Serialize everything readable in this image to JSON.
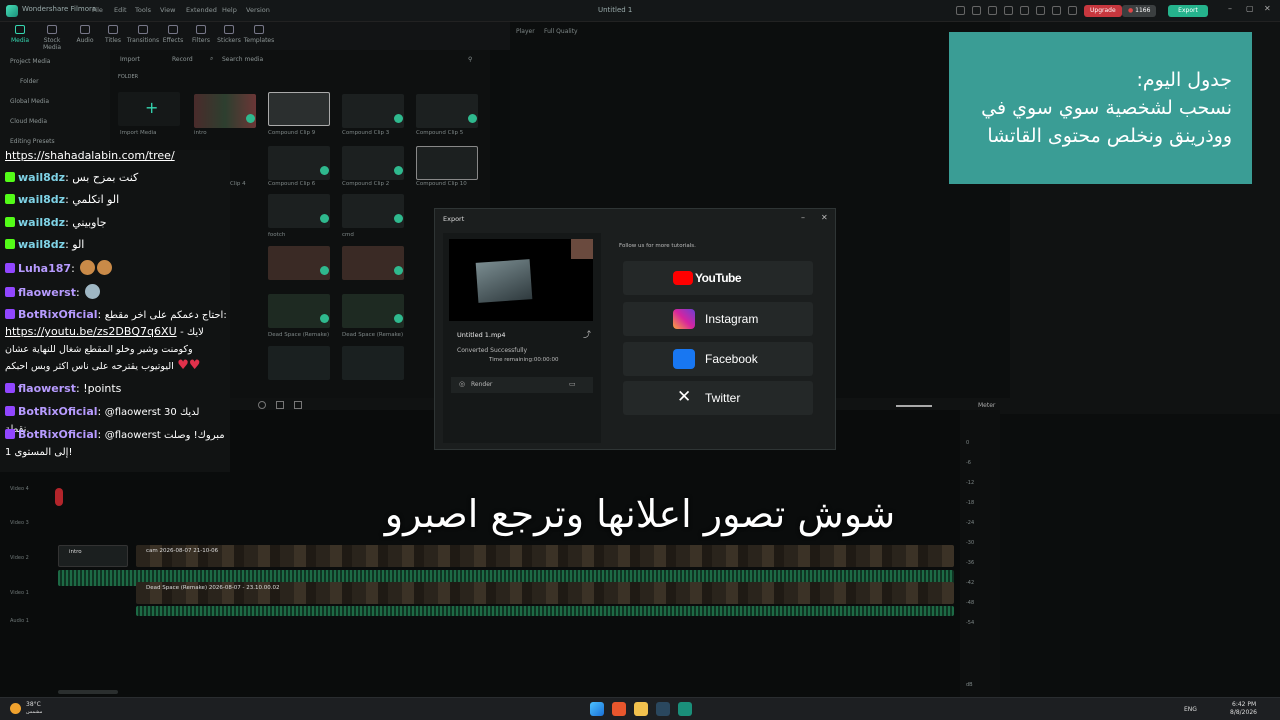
{
  "titlebar": {
    "app_name": "Wondershare Filmora",
    "menus": [
      "File",
      "Edit",
      "Tools",
      "View",
      "Extended",
      "Help",
      "Version"
    ],
    "window_title": "Untitled 1",
    "upgrade": "Upgrade",
    "credits": "1166",
    "export": "Export"
  },
  "toolbar": {
    "tools": [
      "Media",
      "Stock Media",
      "Audio",
      "Titles",
      "Transitions",
      "Effects",
      "Filters",
      "Stickers",
      "Templates"
    ]
  },
  "media": {
    "side_items": [
      "Project Media",
      "Folder",
      "Global Media",
      "Cloud Media",
      "Editing Presets"
    ],
    "import": "Import",
    "record": "Record",
    "search_placeholder": "Search media",
    "folder_label": "FOLDER",
    "import_media": "Import Media",
    "intro": "intro",
    "clip_labels": [
      "Compound Clip 9",
      "Compound Clip 3",
      "Compound Clip 5",
      "Clip 4",
      "Compound Clip 6",
      "Compound Clip 2",
      "Compound Clip 10",
      "footch",
      "cmd",
      "Dead Space (Remake)",
      "Dead Space (Remake)"
    ]
  },
  "player": {
    "label": "Player",
    "quality": "Full Quality"
  },
  "announcement": {
    "lines": [
      "جدول اليوم:",
      "نسحب لشخصية سوي سوي في",
      "ووذرينق ونخلص محتوى القاتشا"
    ]
  },
  "chat": {
    "top_link": "https://shahadalabin.com/tree/",
    "messages": [
      {
        "platform": "kick",
        "user": "wail8dz",
        "text": "كنت بمزح بس"
      },
      {
        "platform": "kick",
        "user": "wail8dz",
        "text": "الو اتكلمي"
      },
      {
        "platform": "kick",
        "user": "wail8dz",
        "text": "جاوبيني"
      },
      {
        "platform": "kick",
        "user": "wail8dz",
        "text": "الو"
      },
      {
        "platform": "twitch",
        "user": "Luha187",
        "text": ""
      },
      {
        "platform": "twitch",
        "user": "flaowerst",
        "text": ""
      },
      {
        "platform": "twitch",
        "user": "BotRixOficial",
        "text": "احتاج دعمكم على اخر مقطع:",
        "link": "https://youtu.be/zs2DBQ7q6XU",
        "text2": "- لايك",
        "text3": "وكومنت وشير وخلو المقطع شغال للنهاية عشان",
        "text4": "اليوتيوب يقترحه على ناس اكثر وبس احبكم"
      },
      {
        "platform": "twitch",
        "user": "flaowerst",
        "text": "!points"
      },
      {
        "platform": "twitch",
        "user": "BotRixOficial",
        "text": "@flaowerst لديك 30 نقطة."
      },
      {
        "platform": "twitch",
        "user": "BotRixOficial",
        "text": "@flaowerst مبروك! وصلت",
        "text2": "إلى المستوى 1!"
      }
    ]
  },
  "caption": "شوش تصور اعلانها وترجع اصبرو",
  "export_dialog": {
    "title": "Export",
    "file_name": "Untitled 1.mp4",
    "status": "Converted Successfully",
    "time_remaining": "Time remaining:00:00:00",
    "render": "Render",
    "follow_text": "Follow us for more tutorials.",
    "socials": [
      {
        "name": "YouTube",
        "color": "#ff0000"
      },
      {
        "name": "Instagram",
        "color": "#c13584"
      },
      {
        "name": "Facebook",
        "color": "#1877f2"
      },
      {
        "name": "Twitter",
        "color": "#ffffff"
      }
    ]
  },
  "timeline": {
    "tracks": [
      "Video 4",
      "Video 3",
      "Video 2",
      "Video 1",
      "Audio 1"
    ],
    "clips": [
      {
        "label": "intro"
      },
      {
        "label": "cam 2026-08-07 21-10-06"
      },
      {
        "label": "Dead Space (Remake) 2026-08-07 - 23.10.00.02"
      }
    ],
    "meter_label": "Meter",
    "meter_ticks": [
      "0",
      "-6",
      "-12",
      "-18",
      "-24",
      "-30",
      "-36",
      "-42",
      "-48",
      "-54",
      "dB"
    ]
  },
  "taskbar": {
    "weather_temp": "38°C",
    "weather_desc": "مشمس",
    "lang": "ENG",
    "time": "6:42 PM",
    "date": "8/8/2026"
  }
}
